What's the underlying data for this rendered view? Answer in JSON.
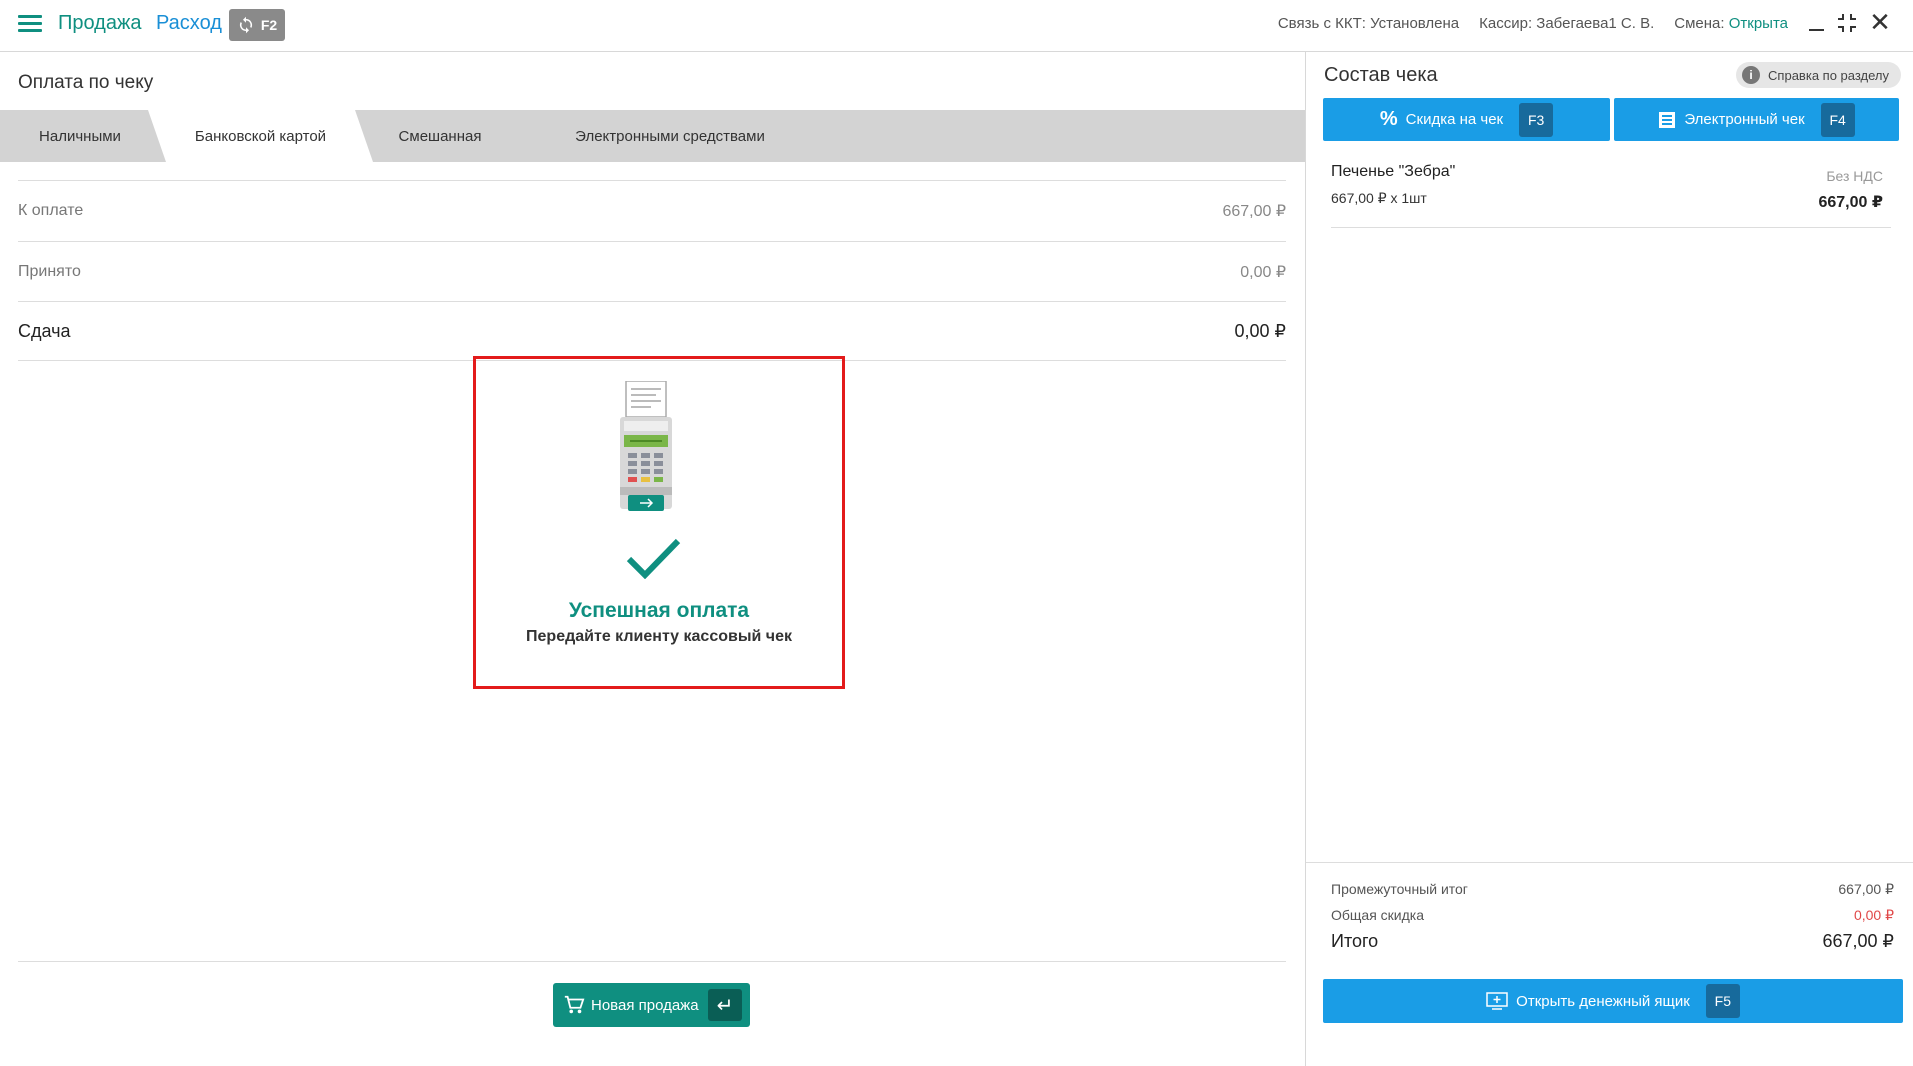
{
  "topbar": {
    "nav_sale": "Продажа",
    "nav_expense": "Расход",
    "sync_key": "F2",
    "kkt_status": "Связь с ККТ: Установлена",
    "cashier": "Кассир: Забегаева1 С. В.",
    "shift_label": "Смена:",
    "shift_value": "Открыта"
  },
  "payment": {
    "title": "Оплата по чеку",
    "tabs": [
      {
        "label": "Наличными",
        "active": false
      },
      {
        "label": "Банковской картой",
        "active": true
      },
      {
        "label": "Смешанная",
        "active": false
      },
      {
        "label": "Электронными средствами",
        "active": false
      }
    ],
    "rows": {
      "due": {
        "label": "К оплате",
        "value": "667,00 ₽"
      },
      "accepted": {
        "label": "Принято",
        "value": "0,00 ₽"
      },
      "change": {
        "label": "Сдача",
        "value": "0,00 ₽"
      }
    },
    "success": {
      "title": "Успешная оплата",
      "subtitle": "Передайте клиенту кассовый чек"
    },
    "new_sale_label": "Новая продажа"
  },
  "receipt": {
    "title": "Состав чека",
    "help_label": "Справка по разделу",
    "discount_label": "Скидка на чек",
    "discount_key": "F3",
    "ereceipt_label": "Электронный чек",
    "ereceipt_key": "F4",
    "items": [
      {
        "name": "Печенье \"Зебра\"",
        "qty": "667,00 ₽ x 1шт",
        "vat": "Без НДС",
        "sum": "667,00 ₽"
      }
    ],
    "totals": {
      "subtotal_label": "Промежуточный итог",
      "subtotal_value": "667,00 ₽",
      "discount_label": "Общая скидка",
      "discount_value": "0,00 ₽",
      "total_label": "Итого",
      "total_value": "667,00 ₽"
    },
    "drawer_label": "Открыть денежный ящик",
    "drawer_key": "F5"
  },
  "colors": {
    "accent_teal": "#0f8f80",
    "accent_blue": "#1a9de6",
    "highlight_red": "#e31b1b",
    "discount_red": "#e04848"
  }
}
